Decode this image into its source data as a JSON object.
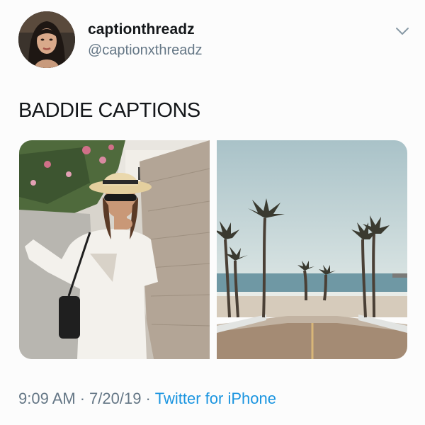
{
  "tweet": {
    "display_name": "captionthreadz",
    "handle": "@captionxthreadz",
    "text": "BADDIE CAPTIONS",
    "time": "9:09 AM",
    "date": "7/20/19",
    "separator": "·",
    "source": "Twitter for iPhone"
  },
  "icons": {
    "menu": "chevron-down-icon"
  },
  "colors": {
    "name_text": "#14171a",
    "secondary_text": "#657786",
    "link": "#1b95e0",
    "background": "#fcfcfc"
  }
}
